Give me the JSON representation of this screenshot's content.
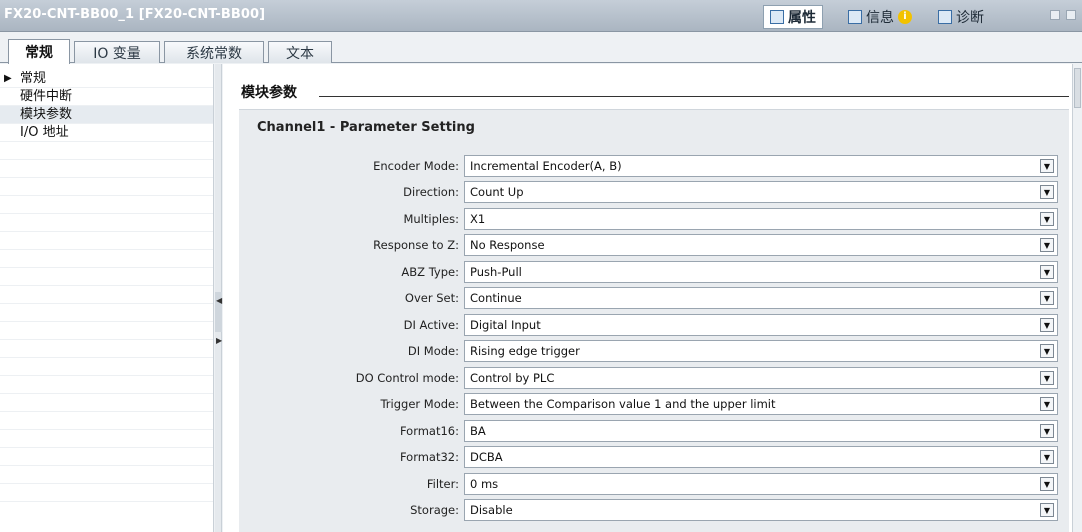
{
  "window": {
    "title": "FX20-CNT-BB00_1 [FX20-CNT-BB00]",
    "inspector_tabs": [
      {
        "label": "属性",
        "icon": "properties-icon"
      },
      {
        "label": "信息",
        "icon": "info-icon"
      },
      {
        "label": "诊断",
        "icon": "diagnostics-icon"
      }
    ]
  },
  "tabs": [
    "常规",
    "IO 变量",
    "系统常数",
    "文本"
  ],
  "nav": {
    "items": [
      {
        "label": "常规"
      },
      {
        "label": "硬件中断"
      },
      {
        "label": "模块参数"
      },
      {
        "label": "I/O 地址"
      }
    ]
  },
  "section": {
    "title": "模块参数",
    "group_title": "Channel1 - Parameter Setting"
  },
  "params": [
    {
      "label": "Encoder Mode:",
      "value": "Incremental Encoder(A, B)"
    },
    {
      "label": "Direction:",
      "value": "Count Up"
    },
    {
      "label": "Multiples:",
      "value": "X1"
    },
    {
      "label": "Response to Z:",
      "value": "No Response"
    },
    {
      "label": "ABZ Type:",
      "value": "Push-Pull"
    },
    {
      "label": "Over Set:",
      "value": "Continue"
    },
    {
      "label": "DI Active:",
      "value": "Digital Input"
    },
    {
      "label": "DI Mode:",
      "value": "Rising edge trigger"
    },
    {
      "label": "DO Control mode:",
      "value": "Control by PLC"
    },
    {
      "label": "Trigger Mode:",
      "value": "Between the Comparison value 1 and the upper limit"
    },
    {
      "label": "Format16:",
      "value": "BA"
    },
    {
      "label": "Format32:",
      "value": "DCBA"
    },
    {
      "label": "Filter:",
      "value": "0 ms"
    },
    {
      "label": "Storage:",
      "value": "Disable"
    }
  ]
}
